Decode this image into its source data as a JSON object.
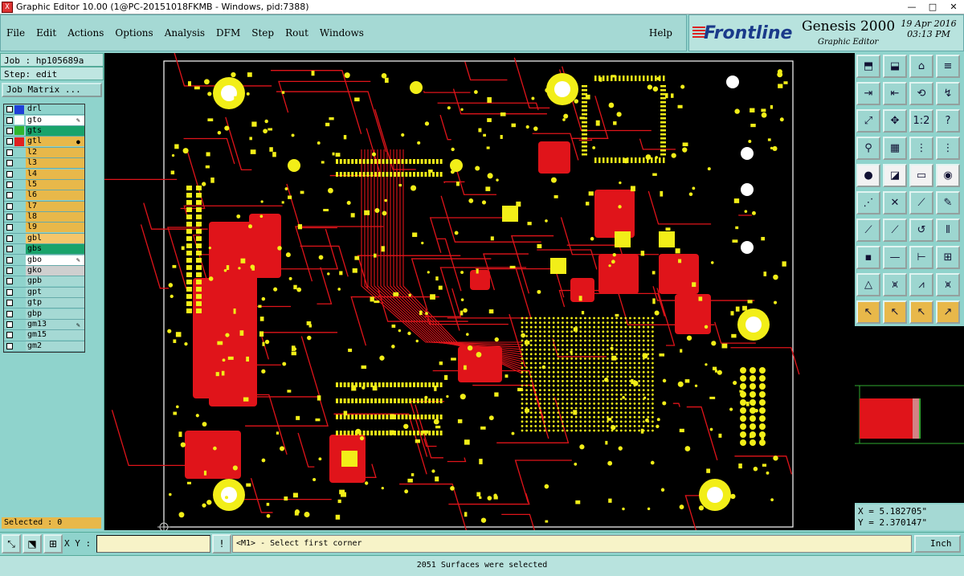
{
  "window": {
    "title": "Graphic Editor 10.00 (1@PC-20151018FKMB - Windows, pid:7388)",
    "app_icon": "X",
    "minimize": "—",
    "maximize": "□",
    "close": "✕"
  },
  "menu": {
    "items": [
      "File",
      "Edit",
      "Actions",
      "Options",
      "Analysis",
      "DFM",
      "Step",
      "Rout",
      "Windows"
    ],
    "help": "Help"
  },
  "brand": {
    "logo": "Frontline",
    "product": "Genesis 2000",
    "subtitle": "Graphic Editor",
    "date": "19 Apr 2016",
    "time": "03:13 PM"
  },
  "job": {
    "job_line": "Job : hp105689a",
    "step_line": "Step: edit",
    "matrix_button": "Job Matrix ..."
  },
  "layers": [
    {
      "name": "drl",
      "swatch": "#1f3fd8",
      "bg": "#8fd3cc",
      "mark": ""
    },
    {
      "name": "gto",
      "swatch": "#ffffff",
      "bg": "#ffffff",
      "mark": "✎"
    },
    {
      "name": "gts",
      "swatch": "#2fb52f",
      "bg": "#19a36b",
      "mark": ""
    },
    {
      "name": "gtl",
      "swatch": "#e02020",
      "bg": "#e8b84a",
      "mark": "●"
    },
    {
      "name": "l2",
      "swatch": "",
      "bg": "#e8b84a",
      "mark": ""
    },
    {
      "name": "l3",
      "swatch": "",
      "bg": "#e8b84a",
      "mark": ""
    },
    {
      "name": "l4",
      "swatch": "",
      "bg": "#e8b84a",
      "mark": ""
    },
    {
      "name": "l5",
      "swatch": "",
      "bg": "#e8b84a",
      "mark": ""
    },
    {
      "name": "l6",
      "swatch": "",
      "bg": "#e8b84a",
      "mark": ""
    },
    {
      "name": "l7",
      "swatch": "",
      "bg": "#e8b84a",
      "mark": ""
    },
    {
      "name": "l8",
      "swatch": "",
      "bg": "#e8b84a",
      "mark": ""
    },
    {
      "name": "l9",
      "swatch": "",
      "bg": "#e8b84a",
      "mark": ""
    },
    {
      "name": "gbl",
      "swatch": "",
      "bg": "#f5c66a",
      "mark": ""
    },
    {
      "name": "gbs",
      "swatch": "",
      "bg": "#19a36b",
      "mark": ""
    },
    {
      "name": "gbo",
      "swatch": "",
      "bg": "#ffffff",
      "mark": "✎"
    },
    {
      "name": "gko",
      "swatch": "",
      "bg": "#cfcfcf",
      "mark": ""
    },
    {
      "name": "gpb",
      "swatch": "",
      "bg": "#a5d9d4",
      "mark": ""
    },
    {
      "name": "gpt",
      "swatch": "",
      "bg": "#a5d9d4",
      "mark": ""
    },
    {
      "name": "gtp",
      "swatch": "",
      "bg": "#a5d9d4",
      "mark": ""
    },
    {
      "name": "gbp",
      "swatch": "",
      "bg": "#a5d9d4",
      "mark": ""
    },
    {
      "name": "gm13",
      "swatch": "",
      "bg": "#a5d9d4",
      "mark": "✎"
    },
    {
      "name": "gm15",
      "swatch": "",
      "bg": "#a5d9d4",
      "mark": ""
    },
    {
      "name": "gm2",
      "swatch": "",
      "bg": "#a5d9d4",
      "mark": ""
    }
  ],
  "selected_count": "Selected : 0",
  "coords": {
    "x": "X = 5.182705\"",
    "y": "Y = 2.370147\""
  },
  "bottom": {
    "xy_label": "X Y :",
    "xy_value": "",
    "alert_button": "!",
    "prompt": "<M1> - Select first corner",
    "units": "Inch"
  },
  "status": "2051 Surfaces were selected",
  "colors": {
    "copper": "#e0141a",
    "pad": "#f2ee18",
    "outline": "#ffffff",
    "panel": "#8fd3cc"
  }
}
